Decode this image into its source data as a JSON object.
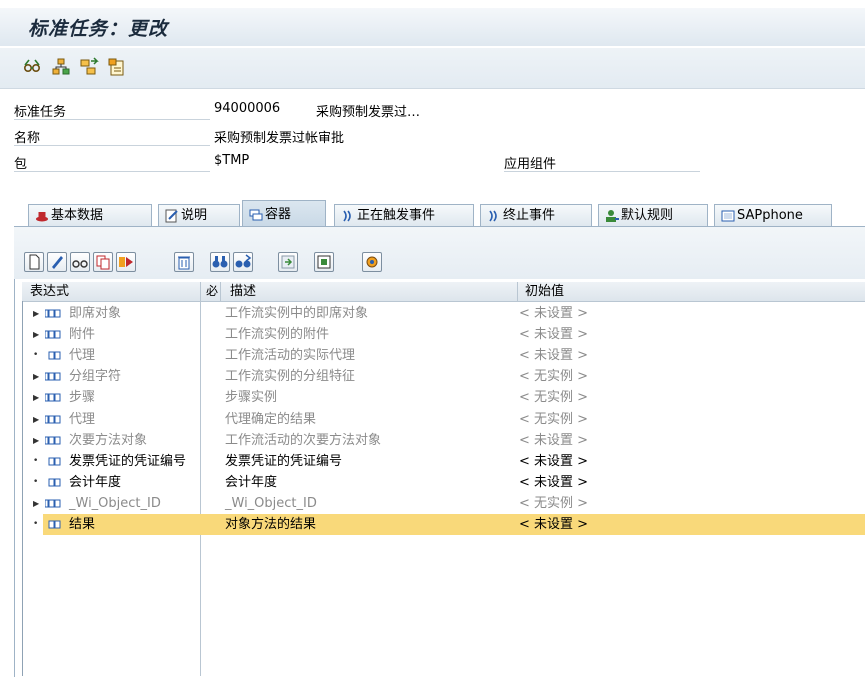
{
  "window": {
    "title": "标准任务：更改"
  },
  "toolbar": {
    "buttons": [
      {
        "name": "glasses-icon"
      },
      {
        "name": "org-assign-icon"
      },
      {
        "name": "binding-icon"
      },
      {
        "name": "task-info-icon"
      }
    ]
  },
  "header": {
    "fields": [
      {
        "label": "标准任务",
        "value": "94000006",
        "extra": "采购预制发票过…"
      },
      {
        "label": "名称",
        "value": "采购预制发票过帐审批",
        "extra": ""
      },
      {
        "label": "包",
        "value": "$TMP",
        "extra": ""
      }
    ],
    "component_label": "应用组件",
    "component_value": ""
  },
  "tabs": [
    {
      "label": "基本数据",
      "icon": "hat-icon",
      "active": false
    },
    {
      "label": "说明",
      "icon": "edit-doc-icon",
      "active": false
    },
    {
      "label": "容器",
      "icon": "container-icon",
      "active": true
    },
    {
      "label": "正在触发事件",
      "icon": "event-icon",
      "active": false
    },
    {
      "label": "终止事件",
      "icon": "event-icon",
      "active": false
    },
    {
      "label": "默认规则",
      "icon": "rule-icon",
      "active": false
    },
    {
      "label": "SAPphone",
      "icon": "phone-icon",
      "active": false
    }
  ],
  "container_toolbar": {
    "buttons": [
      "new-icon",
      "edit-pencil-icon",
      "display-glasses-icon",
      "copy-icon",
      "forward-icon",
      "delete-icon",
      "find-icon",
      "find-next-icon",
      "import-icon",
      "export-icon",
      "settings-icon"
    ]
  },
  "grid": {
    "columns": {
      "expression": "表达式",
      "required": "必",
      "description": "描述",
      "initial": "初始值"
    },
    "rows": [
      {
        "expression": "即席对象",
        "description": "工作流实例中的即席对象",
        "initial": "< 未设置 >",
        "expandable": true,
        "dim": true,
        "selected": false
      },
      {
        "expression": "附件",
        "description": "工作流实例的附件",
        "initial": "< 未设置 >",
        "expandable": true,
        "dim": true,
        "selected": false
      },
      {
        "expression": "代理",
        "description": "工作流活动的实际代理",
        "initial": "< 未设置 >",
        "expandable": false,
        "dim": true,
        "selected": false
      },
      {
        "expression": "分组字符",
        "description": "工作流实例的分组特征",
        "initial": "< 无实例 >",
        "expandable": true,
        "dim": true,
        "selected": false
      },
      {
        "expression": "步骤",
        "description": "步骤实例",
        "initial": "< 无实例 >",
        "expandable": true,
        "dim": true,
        "selected": false
      },
      {
        "expression": "代理",
        "description": "代理确定的结果",
        "initial": "< 无实例 >",
        "expandable": true,
        "dim": true,
        "selected": false
      },
      {
        "expression": "次要方法对象",
        "description": "工作流活动的次要方法对象",
        "initial": "< 未设置 >",
        "expandable": true,
        "dim": true,
        "selected": false
      },
      {
        "expression": "发票凭证的凭证编号",
        "description": "发票凭证的凭证编号",
        "initial": "< 未设置 >",
        "expandable": false,
        "dim": false,
        "selected": false
      },
      {
        "expression": "会计年度",
        "description": "会计年度",
        "initial": "< 未设置 >",
        "expandable": false,
        "dim": false,
        "selected": false
      },
      {
        "expression": "_Wi_Object_ID",
        "description": "_Wi_Object_ID",
        "initial": "< 无实例 >",
        "expandable": true,
        "dim": true,
        "selected": false
      },
      {
        "expression": "结果",
        "description": "对象方法的结果",
        "initial": "< 未设置 >",
        "expandable": false,
        "dim": false,
        "selected": true
      }
    ]
  },
  "colors": {
    "selection": "#f9d97a",
    "node_blue": "#2a5fb0",
    "dim_text": "#8b8b8b"
  }
}
